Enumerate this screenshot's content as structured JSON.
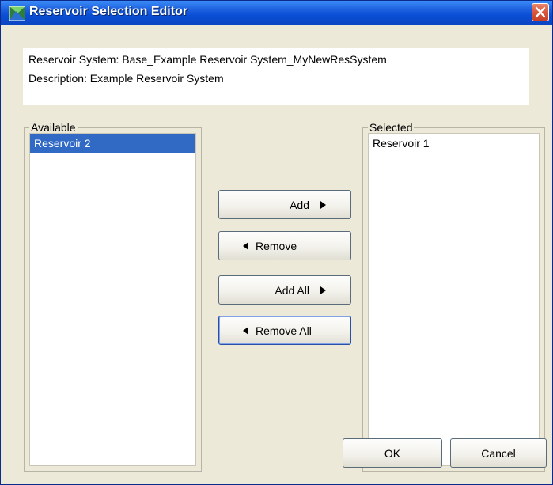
{
  "window": {
    "title": "Reservoir Selection Editor",
    "accent_color": "#0a4fd6",
    "close_icon": "close-icon"
  },
  "info": {
    "system_line": "Reservoir System: Base_Example Reservoir System_MyNewResSystem",
    "description_line": "Description: Example Reservoir System"
  },
  "available": {
    "label": "Available",
    "items": [
      {
        "label": "Reservoir 2",
        "selected": true
      }
    ]
  },
  "selected": {
    "label": "Selected",
    "items": [
      {
        "label": "Reservoir 1",
        "selected": false
      }
    ]
  },
  "buttons": {
    "add": "Add",
    "remove": "Remove",
    "add_all": "Add All",
    "remove_all": "Remove All",
    "ok": "OK",
    "cancel": "Cancel"
  },
  "colors": {
    "selection": "#316ac5",
    "dialog_bg": "#ece9d8"
  }
}
